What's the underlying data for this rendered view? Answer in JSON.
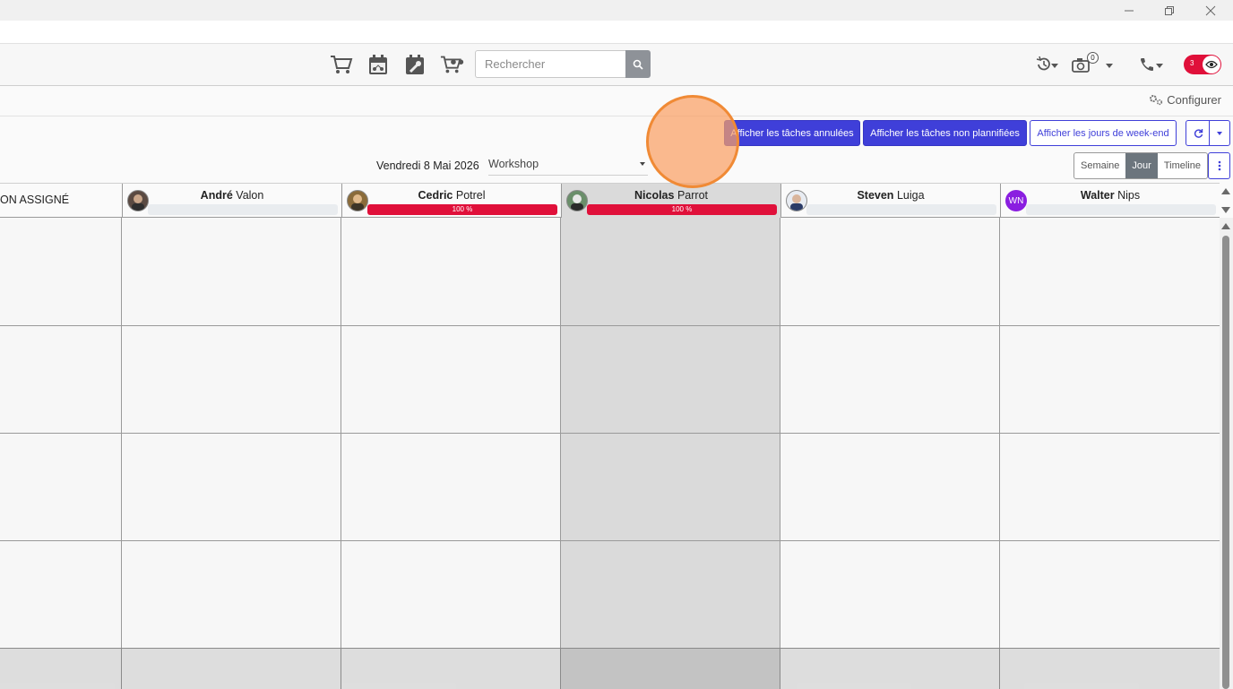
{
  "window": {
    "minimize_icon": "minimize-icon",
    "restore_icon": "restore-icon",
    "close_icon": "close-icon"
  },
  "navbar": {
    "icons": [
      "cart-icon",
      "calendar-moto-icon",
      "calendar-wrench-icon",
      "cart-moto-icon"
    ],
    "search": {
      "placeholder": "Rechercher",
      "icon": "search-icon"
    },
    "history_icon": "history-icon",
    "camera_icon": "camera-icon",
    "camera_badge": "0",
    "phone_icon": "phone-icon",
    "toggle": {
      "badge": "3",
      "icon": "eye-icon",
      "color": "#e0103a"
    }
  },
  "subheader": {
    "configure_label": "Configurer",
    "configure_icon": "gears-icon"
  },
  "toolbar": {
    "show_cancelled": "Afficher les tâches annulées",
    "show_unplanned": "Afficher les tâches non plannifiées",
    "show_weekend": "Afficher les jours de week-end",
    "refresh_icon": "refresh-icon",
    "dropdown_icon": "caret-down-icon",
    "views": [
      "Semaine",
      "Jour",
      "Timeline"
    ],
    "active_view": "Jour",
    "more_icon": "vertical-dots-icon",
    "accent": "#3f3fd9"
  },
  "calendar": {
    "date_label": "Vendredi 8 Mai 2026",
    "workshop": "Workshop",
    "unassigned_label": "ON ASSIGNÉ",
    "resources": [
      {
        "first": "André",
        "last": "Valon",
        "progress": null,
        "progress_label": ""
      },
      {
        "first": "Cedric",
        "last": "Potrel",
        "progress": 100,
        "progress_label": "100 %"
      },
      {
        "first": "Nicolas",
        "last": "Parrot",
        "progress": 100,
        "progress_label": "100 %"
      },
      {
        "first": "Steven",
        "last": "Luiga",
        "progress": null,
        "progress_label": ""
      },
      {
        "first": "Walter",
        "last": "Nips",
        "progress": null,
        "progress_label": "",
        "initials": "WN"
      }
    ],
    "progress_color": "#e0103a"
  }
}
